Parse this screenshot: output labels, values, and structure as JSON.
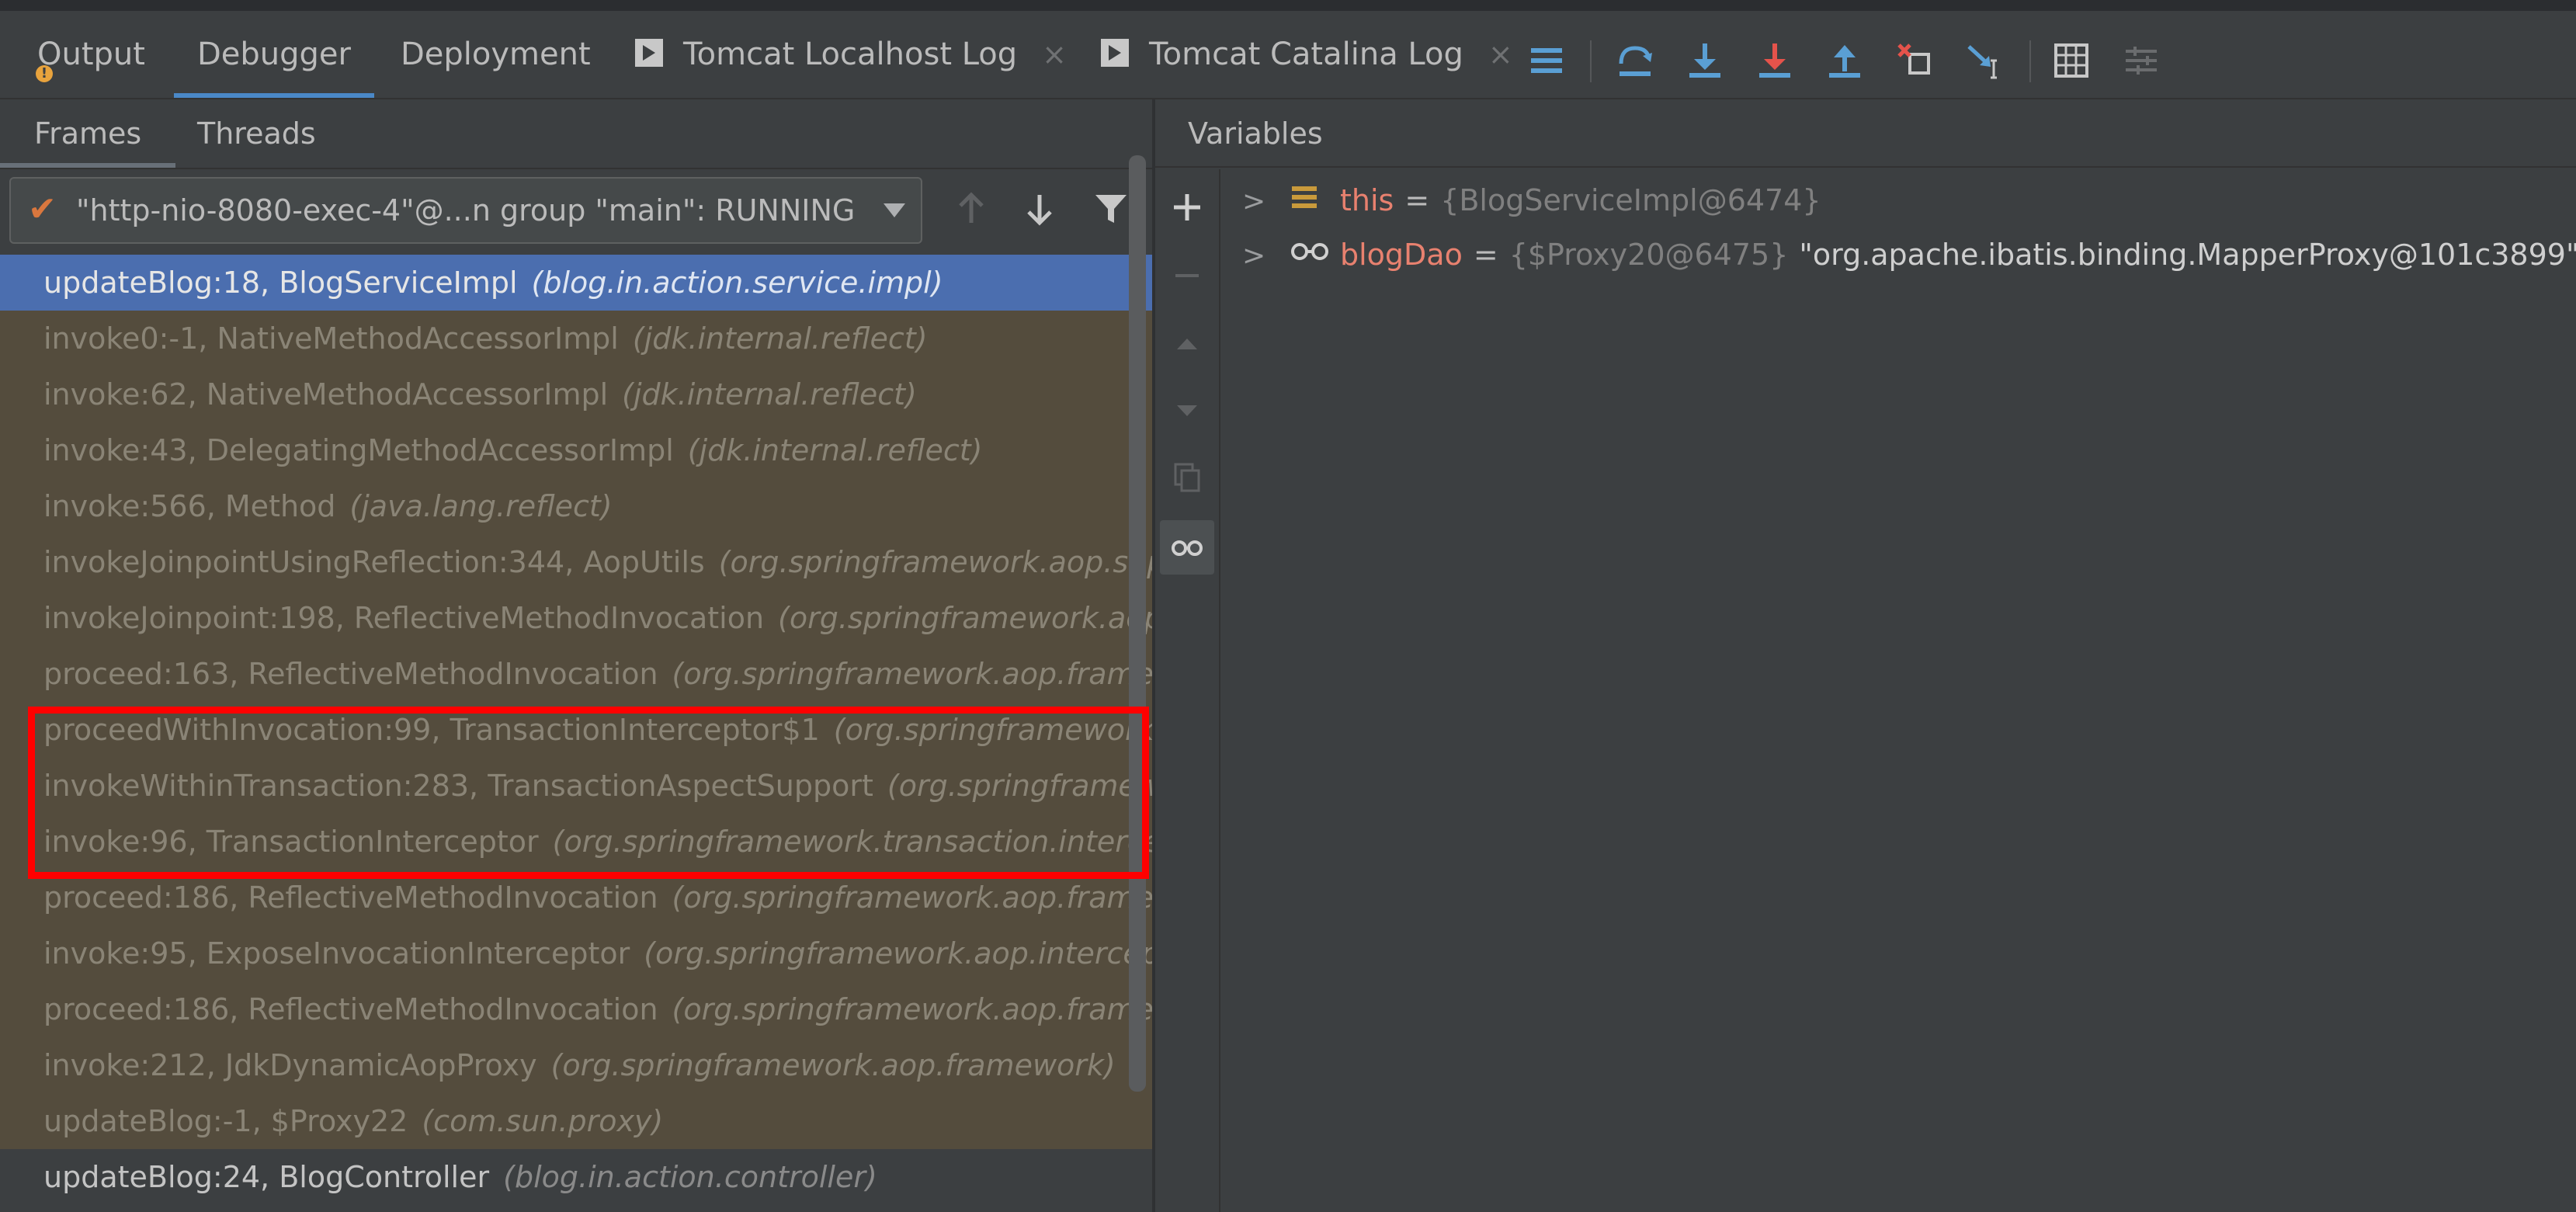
{
  "top_tabs": [
    {
      "label": "Output"
    },
    {
      "label": "Debugger"
    },
    {
      "label": "Deployment"
    },
    {
      "label": "Tomcat Localhost Log",
      "close": "×"
    },
    {
      "label": "Tomcat Catalina Log",
      "close": "×"
    }
  ],
  "toolbar_icons": [
    "show-execution-point-icon",
    "step-over-icon",
    "step-into-icon",
    "force-step-into-icon",
    "step-out-icon",
    "drop-frame-icon",
    "run-to-cursor-icon",
    "evaluate-expression-icon",
    "trace-current-stream-icon"
  ],
  "sub_tabs": {
    "frames": "Frames",
    "threads": "Threads"
  },
  "thread_selector": {
    "value": "\"http-nio-8080-exec-4\"@...n group \"main\": RUNNING"
  },
  "frames": [
    {
      "method": "updateBlog:18, BlogServiceImpl",
      "pkg": "(blog.in.action.service.impl)",
      "state": "selected"
    },
    {
      "method": "invoke0:-1, NativeMethodAccessorImpl",
      "pkg": "(jdk.internal.reflect)",
      "state": "library"
    },
    {
      "method": "invoke:62, NativeMethodAccessorImpl",
      "pkg": "(jdk.internal.reflect)",
      "state": "library"
    },
    {
      "method": "invoke:43, DelegatingMethodAccessorImpl",
      "pkg": "(jdk.internal.reflect)",
      "state": "library"
    },
    {
      "method": "invoke:566, Method",
      "pkg": "(java.lang.reflect)",
      "state": "library"
    },
    {
      "method": "invokeJoinpointUsingReflection:344, AopUtils",
      "pkg": "(org.springframework.aop.supp",
      "state": "library"
    },
    {
      "method": "invokeJoinpoint:198, ReflectiveMethodInvocation",
      "pkg": "(org.springframework.aop.fr",
      "state": "library"
    },
    {
      "method": "proceed:163, ReflectiveMethodInvocation",
      "pkg": "(org.springframework.aop.framewo",
      "state": "library"
    },
    {
      "method": "proceedWithInvocation:99, TransactionInterceptor$1",
      "pkg": "(org.springframework.tr",
      "state": "library"
    },
    {
      "method": "invokeWithinTransaction:283, TransactionAspectSupport",
      "pkg": "(org.springframewo",
      "state": "library"
    },
    {
      "method": "invoke:96, TransactionInterceptor",
      "pkg": "(org.springframework.transaction.intercept",
      "state": "library"
    },
    {
      "method": "proceed:186, ReflectiveMethodInvocation",
      "pkg": "(org.springframework.aop.framewo",
      "state": "library"
    },
    {
      "method": "invoke:95, ExposeInvocationInterceptor",
      "pkg": "(org.springframework.aop.interceptor",
      "state": "library"
    },
    {
      "method": "proceed:186, ReflectiveMethodInvocation",
      "pkg": "(org.springframework.aop.framewo",
      "state": "library"
    },
    {
      "method": "invoke:212, JdkDynamicAopProxy",
      "pkg": "(org.springframework.aop.framework)",
      "state": "library"
    },
    {
      "method": "updateBlog:-1, $Proxy22",
      "pkg": "(com.sun.proxy)",
      "state": "library"
    },
    {
      "method": "updateBlog:24, BlogController",
      "pkg": "(blog.in.action.controller)",
      "state": "normal"
    }
  ],
  "variables_header": "Variables",
  "variables": [
    {
      "name": "this",
      "type": "{BlogServiceImpl@6474}",
      "value": "",
      "icon": "field-icon"
    },
    {
      "name": "blogDao",
      "type": "{$Proxy20@6475}",
      "value": "\"org.apache.ibatis.binding.MapperProxy@101c3899\"",
      "icon": "watch-glasses-icon"
    }
  ],
  "colors": {
    "selected_frame": "#4b6eaf",
    "library_frame": "#544c3d",
    "highlight_box": "#ff0000",
    "var_name": "#e8816f"
  }
}
